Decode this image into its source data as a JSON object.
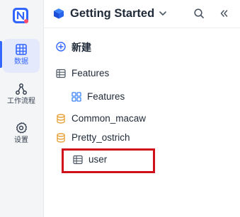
{
  "rail": {
    "items": [
      {
        "label": "数据",
        "icon": "grid-table-icon",
        "active": true
      },
      {
        "label": "工作流程",
        "icon": "workflow-icon",
        "active": false
      },
      {
        "label": "设置",
        "icon": "gear-icon",
        "active": false
      }
    ],
    "logo": "N"
  },
  "header": {
    "title": "Getting Started"
  },
  "tree": {
    "new_label": "新建",
    "items": [
      {
        "label": "Features",
        "icon": "table-icon"
      },
      {
        "label": "Features",
        "icon": "grid-view-icon"
      },
      {
        "label": "Common_macaw",
        "icon": "database-icon"
      },
      {
        "label": "Pretty_ostrich",
        "icon": "database-icon"
      },
      {
        "label": "user",
        "icon": "table-icon"
      }
    ]
  },
  "colors": {
    "accent": "#3366ff",
    "database": "#e8a23a",
    "highlight": "#d0111b"
  }
}
